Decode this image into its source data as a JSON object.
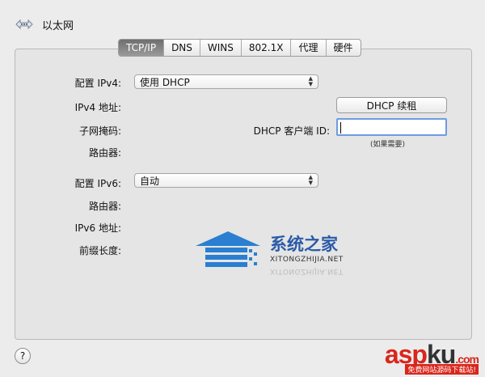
{
  "header": {
    "title": "以太网",
    "icon": "network-arrows-icon"
  },
  "tabs": [
    {
      "label": "TCP/IP",
      "active": true
    },
    {
      "label": "DNS",
      "active": false
    },
    {
      "label": "WINS",
      "active": false
    },
    {
      "label": "802.1X",
      "active": false
    },
    {
      "label": "代理",
      "active": false
    },
    {
      "label": "硬件",
      "active": false
    }
  ],
  "ipv4": {
    "configure_label": "配置 IPv4:",
    "configure_value": "使用 DHCP",
    "address_label": "IPv4 地址:",
    "subnet_label": "子网掩码:",
    "router_label": "路由器:",
    "renew_button": "DHCP 续租",
    "client_id_label": "DHCP 客户端 ID:",
    "client_id_value": "",
    "client_id_hint": "(如果需要)"
  },
  "ipv6": {
    "configure_label": "配置 IPv6:",
    "configure_value": "自动",
    "router_label": "路由器:",
    "address_label": "IPv6 地址:",
    "prefix_label": "前缀长度:"
  },
  "help_button": "?",
  "watermark": {
    "text": "系统之家",
    "sub": "XITONGZHIJIA.NET"
  },
  "site_watermark": {
    "asp": "asp",
    "ku": "ku",
    "com": ".com",
    "sub": "免费网站源码下载站!"
  },
  "colors": {
    "focus": "#6d9be3",
    "active_tab": "#7a7a7a",
    "brand_red": "#d9261c"
  }
}
